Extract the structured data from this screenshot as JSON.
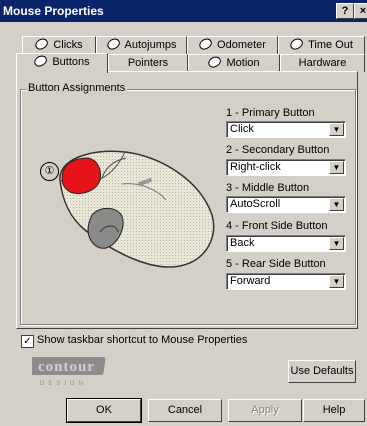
{
  "window": {
    "title": "Mouse Properties",
    "help_glyph": "?",
    "close_glyph": "×"
  },
  "tabs": {
    "row1": [
      "Clicks",
      "Autojumps",
      "Odometer",
      "Time Out"
    ],
    "row2": [
      "Buttons",
      "Pointers",
      "Motion",
      "Hardware"
    ],
    "active": "Buttons"
  },
  "group": {
    "title": "Button Assignments"
  },
  "callout": "①",
  "assignments": [
    {
      "label": "1 - Primary Button",
      "value": "Click"
    },
    {
      "label": "2 - Secondary Button",
      "value": "Right-click"
    },
    {
      "label": "3 - Middle Button",
      "value": "AutoScroll"
    },
    {
      "label": "4 - Front Side Button",
      "value": "Back"
    },
    {
      "label": "5 - Rear Side Button",
      "value": "Forward"
    }
  ],
  "dropdown_arrow": "▼",
  "checkbox": {
    "label": "Show taskbar shortcut to Mouse Properties",
    "checked": true,
    "mark": "✓"
  },
  "logo": {
    "text": "contour",
    "subtitle": "DESIGN"
  },
  "buttons": {
    "use_defaults": "Use Defaults",
    "ok": "OK",
    "cancel": "Cancel",
    "apply": "Apply",
    "help": "Help"
  },
  "colors": {
    "titlebar": "#0a246a",
    "face": "#d4d0c8",
    "primary_button_highlight": "#e8141b"
  }
}
